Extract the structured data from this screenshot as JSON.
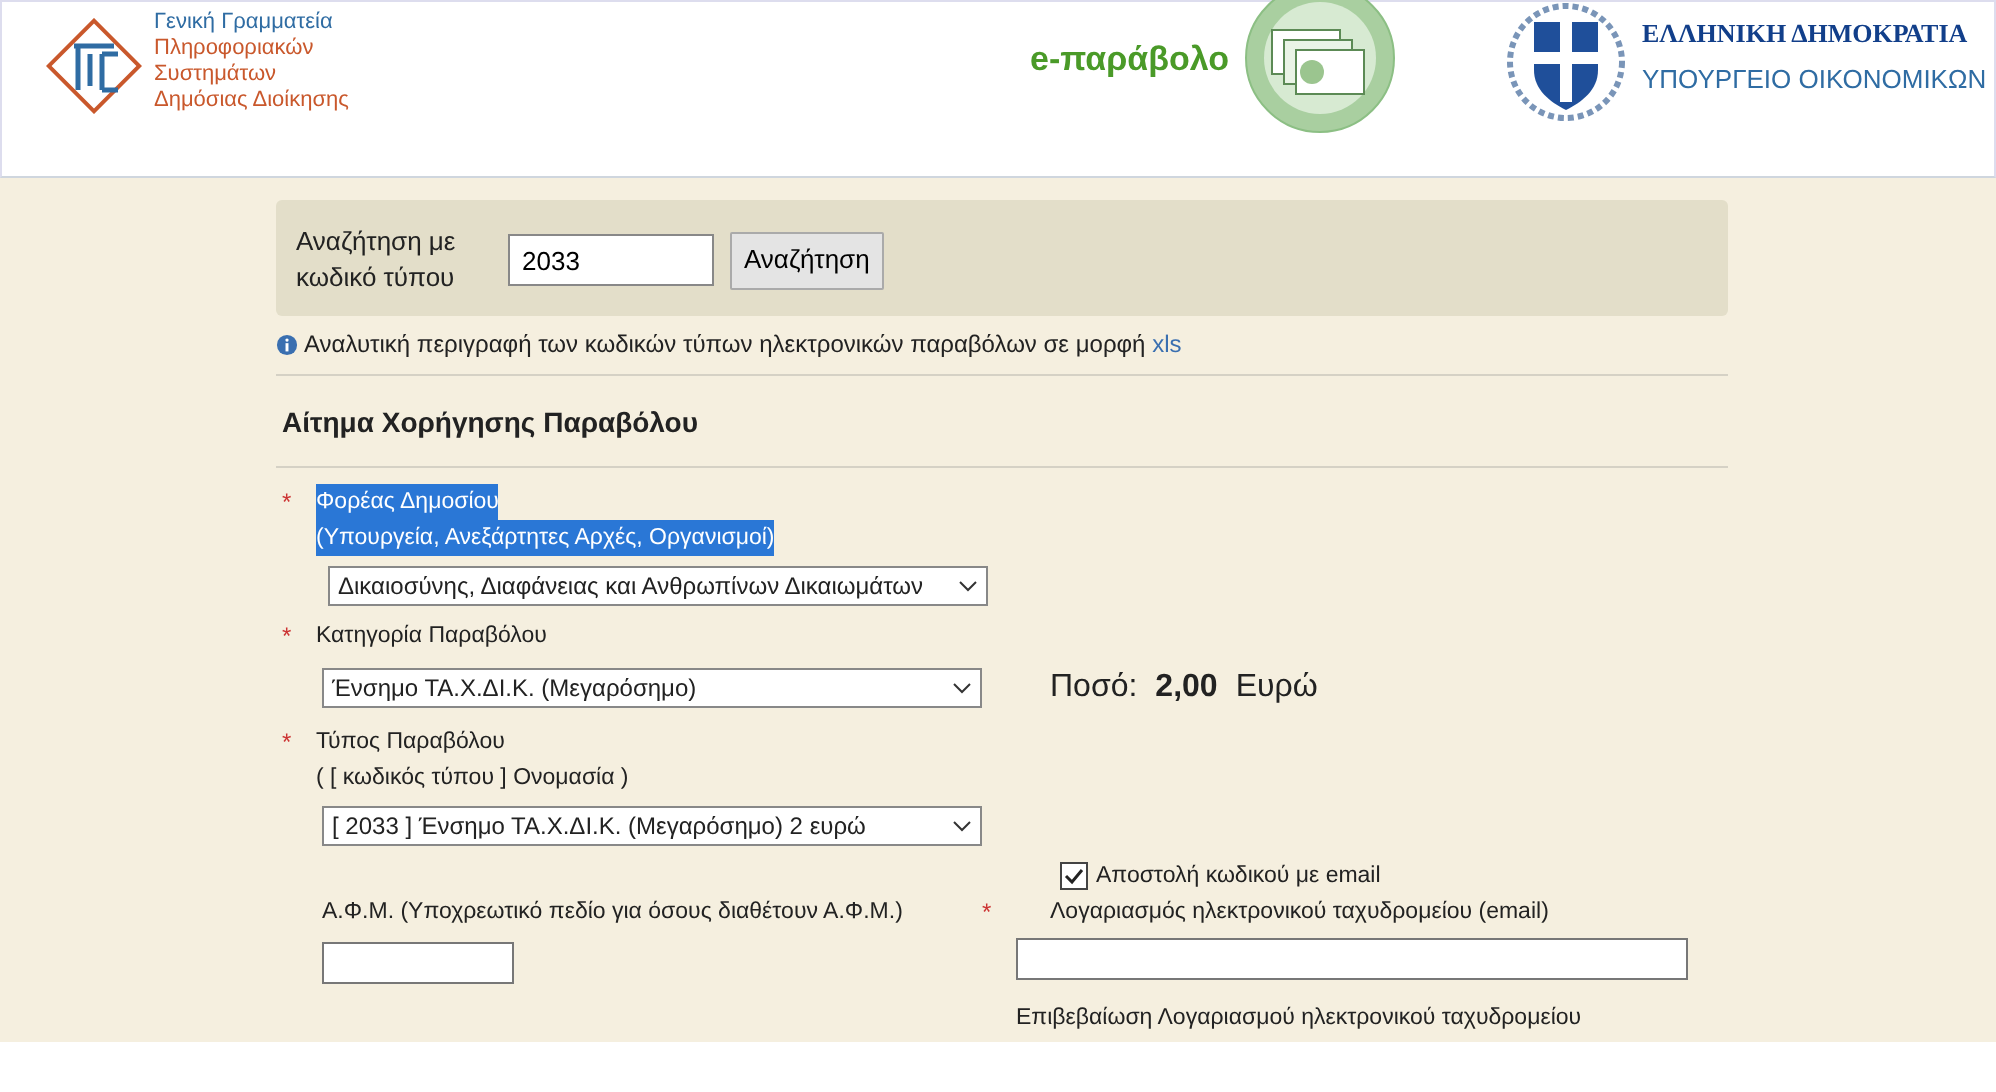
{
  "header": {
    "agency_name": "Γενική Γραμματεία",
    "agency_detail": [
      "Πληροφοριακών",
      "Συστημάτων",
      "Δημόσιας Διοίκησης"
    ],
    "app_name": "e-παράβολο",
    "republic": "ΕΛΛΗΝΙΚΗ ΔΗΜΟΚΡΑΤΙΑ",
    "ministry": "ΥΠΟΥΡΓΕΙΟ ΟΙΚΟΝΟΜΙΚΩΝ"
  },
  "search": {
    "label": "Αναζήτηση με κωδικό τύπου",
    "value": "2033",
    "button": "Αναζήτηση"
  },
  "info": {
    "text": "Αναλυτική περιγραφή των κωδικών τύπων ηλεκτρονικών παραβόλων σε μορφή",
    "link": "xls"
  },
  "section_title": "Αίτημα Χορήγησης Παραβόλου",
  "fields": [
    {
      "label": "Φορέας Δημοσίου",
      "hint": "(Υπουργεία, Ανεξάρτητες Αρχές, Οργανισμοί)",
      "marker": "*",
      "highlighted": true,
      "value": "Δικαιοσύνης, Διαφάνειας και Ανθρωπίνων Δικαιωμάτων"
    },
    {
      "label": "Κατηγορία Παραβόλου",
      "marker": "*",
      "highlighted": false,
      "value": "Ένσημο ΤΑ.Χ.ΔΙ.Κ. (Μεγαρόσημο)"
    },
    {
      "label": "Τύπος Παραβόλου",
      "hint": "( [ κωδικός τύπου ] Ονομασία )",
      "marker": "*",
      "highlighted": false,
      "value": "[ 2033 ] Ένσημο ΤΑ.Χ.ΔΙ.Κ. (Μεγαρόσημο) 2 ευρώ"
    }
  ],
  "amount": {
    "label": "Ποσό:",
    "value": "2,00",
    "currency": "Ευρώ"
  },
  "email_option": {
    "label": "Αποστολή κωδικού με email",
    "checked": true
  },
  "afm": {
    "label": "Α.Φ.Μ. (Υποχρεωτικό πεδίο για όσους διαθέτουν Α.Φ.Μ.)"
  },
  "email": {
    "label": "Λογαριασμός ηλεκτρονικού ταχυδρομείου (email)",
    "marker": "*"
  },
  "email_confirm": {
    "label": "Επιβεβαίωση Λογαριασμού ηλεκτρονικού ταχυδρομείου"
  }
}
